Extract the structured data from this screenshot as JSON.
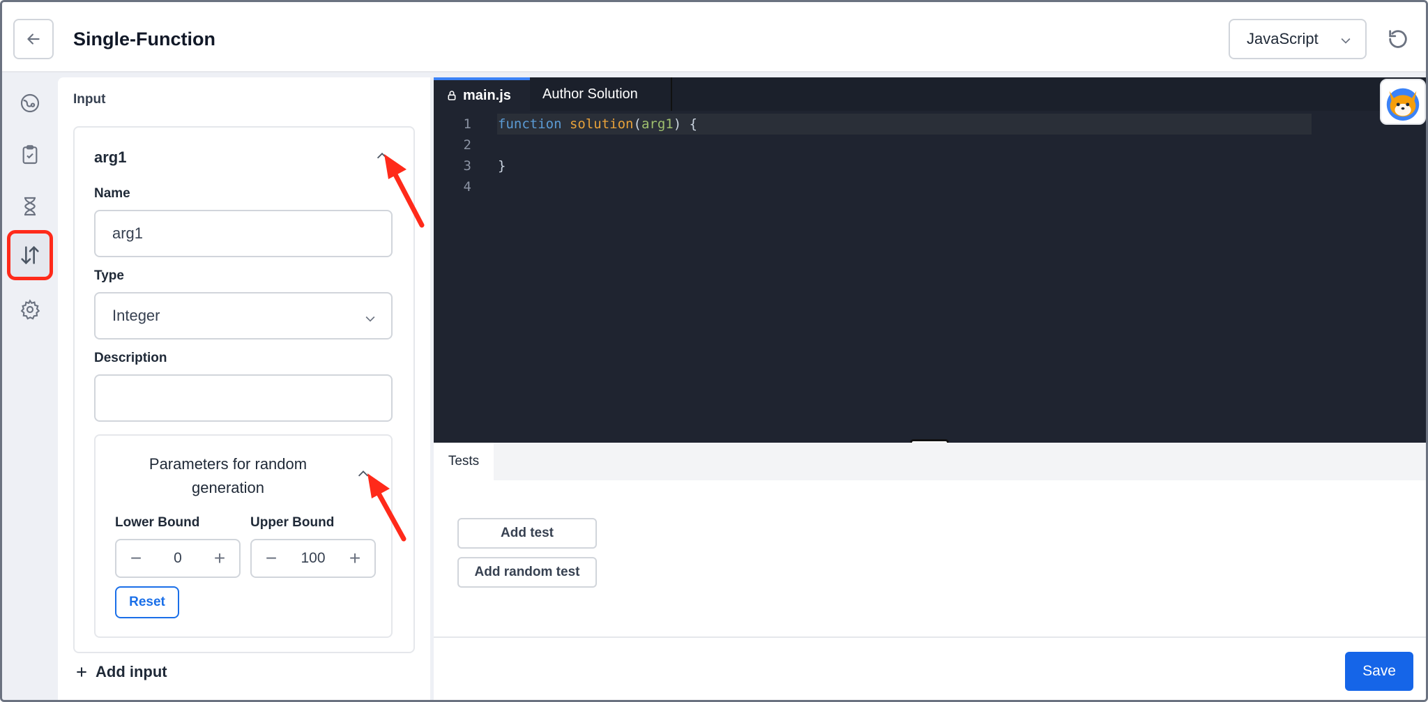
{
  "header": {
    "title": "Single-Function",
    "language": "JavaScript"
  },
  "rail": {
    "items": [
      {
        "icon": "palette-icon"
      },
      {
        "icon": "clipboard-check-icon"
      },
      {
        "icon": "hourglass-icon"
      },
      {
        "icon": "arrows-up-down-icon"
      },
      {
        "icon": "gear-icon"
      }
    ]
  },
  "input_panel": {
    "title": "Input",
    "arg": {
      "header": "arg1",
      "name_label": "Name",
      "name_value": "arg1",
      "type_label": "Type",
      "type_value": "Integer",
      "description_label": "Description",
      "description_value": "",
      "params": {
        "title": "Parameters for random generation",
        "lower_label": "Lower Bound",
        "lower_value": "0",
        "upper_label": "Upper Bound",
        "upper_value": "100",
        "reset_label": "Reset"
      }
    },
    "add_input_label": "Add input"
  },
  "editor": {
    "tabs": [
      {
        "label": "main.js",
        "active": true
      },
      {
        "label": "Author Solution",
        "active": false
      }
    ],
    "line_numbers": [
      "1",
      "2",
      "3",
      "4"
    ],
    "code": {
      "keyword": "function",
      "fn_name": "solution",
      "open": "(",
      "param": "arg1",
      "close": ") {",
      "closing_brace": "}"
    }
  },
  "tests": {
    "tab_label": "Tests",
    "add_test_label": "Add test",
    "add_random_test_label": "Add random test"
  },
  "footer": {
    "save_label": "Save"
  },
  "colors": {
    "accent": "#1565e8",
    "annotation": "#ff2a1a",
    "editor_bg": "#1f2430"
  }
}
